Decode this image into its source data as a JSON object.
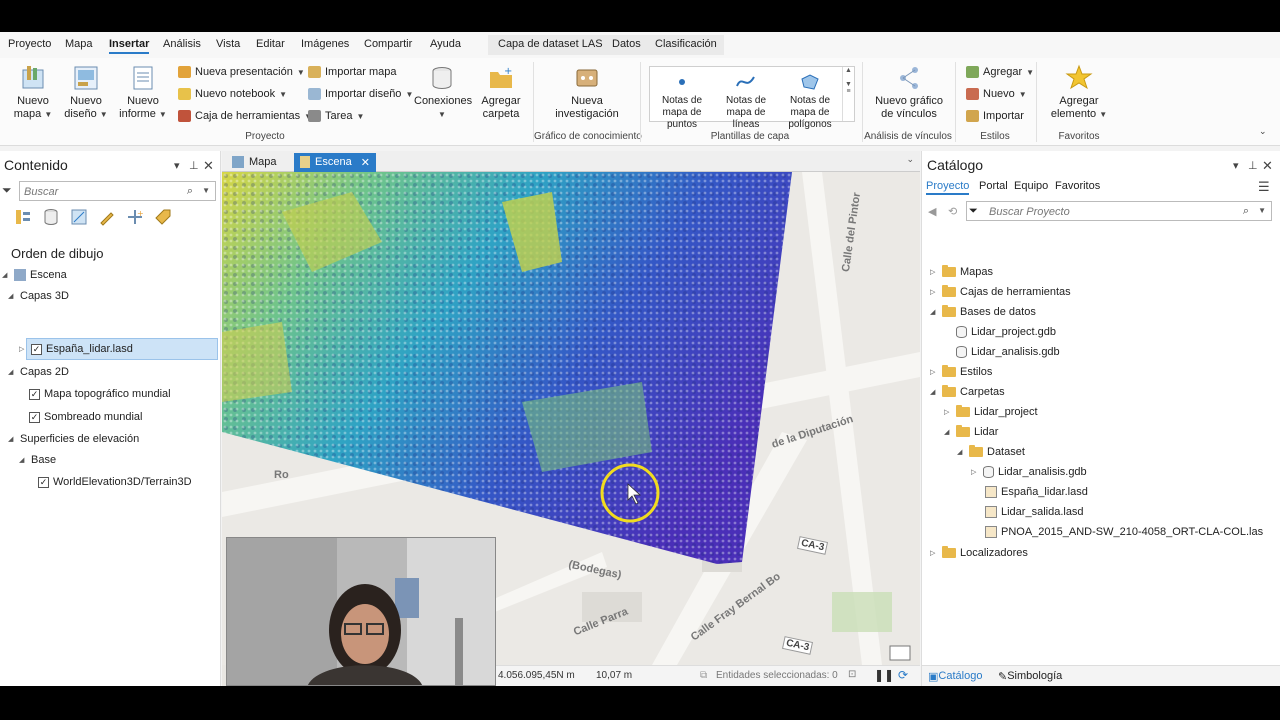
{
  "ribbon_tabs": [
    "Proyecto",
    "Mapa",
    "Insertar",
    "Análisis",
    "Vista",
    "Editar",
    "Imágenes",
    "Compartir",
    "Ayuda"
  ],
  "active_tab": "Insertar",
  "contextual_tabs": [
    "Capa de dataset LAS",
    "Datos",
    "Clasificación"
  ],
  "ribbon": {
    "nuevo_mapa": "Nuevo mapa",
    "nuevo_diseno": "Nuevo diseño",
    "nuevo_informe": "Nuevo informe",
    "nueva_presentacion": "Nueva presentación",
    "nuevo_notebook": "Nuevo notebook",
    "caja_herramientas": "Caja de herramientas",
    "importar_mapa": "Importar mapa",
    "importar_diseno": "Importar diseño",
    "tarea": "Tarea",
    "conexiones": "Conexiones",
    "agregar_carpeta": "Agregar carpeta",
    "group_proyecto": "Proyecto",
    "nueva_investigacion": "Nueva investigación",
    "group_grafico": "Gráfico de conocimiento",
    "notas_puntos": "Notas de mapa de puntos",
    "notas_lineas": "Notas de mapa de líneas",
    "notas_poligonos": "Notas de mapa de polígonos",
    "group_plantillas": "Plantillas de capa",
    "nuevo_grafico_vinculos": "Nuevo gráfico de vínculos",
    "group_analisis_vinculos": "Análisis de vínculos",
    "agregar": "Agregar",
    "nuevo": "Nuevo",
    "importar": "Importar",
    "group_estilos": "Estilos",
    "agregar_elemento": "Agregar elemento",
    "group_favoritos": "Favoritos"
  },
  "contents": {
    "title": "Contenido",
    "search_placeholder": "Buscar",
    "draw_order": "Orden de dibujo",
    "escena": "Escena",
    "capas3d": "Capas 3D",
    "layer_lidar": "España_lidar.lasd",
    "capas2d": "Capas 2D",
    "layer_topo": "Mapa topográfico mundial",
    "layer_sombreado": "Sombreado mundial",
    "superficies": "Superficies de elevación",
    "base": "Base",
    "layer_terrain": "WorldElevation3D/Terrain3D"
  },
  "view": {
    "tab_mapa": "Mapa",
    "tab_escena": "Escena",
    "streets": [
      "Calle del Pintor",
      "Calle Parra",
      "(Bodegas)",
      "Calle Fray Bernal Bo",
      "de la Diputación",
      "CA-3",
      "CA-3",
      "Ro"
    ],
    "coordinate": "4.056.095,45N m",
    "scale": "10,07 m",
    "selected": "Entidades seleccionadas: 0"
  },
  "catalog": {
    "title": "Catálogo",
    "tabs": [
      "Proyecto",
      "Portal",
      "Equipo",
      "Favoritos"
    ],
    "search_placeholder": "Buscar Proyecto",
    "items": {
      "mapas": "Mapas",
      "cajas": "Cajas de herramientas",
      "bases": "Bases de datos",
      "gdb1": "Lidar_project.gdb",
      "gdb2": "Lidar_analisis.gdb",
      "estilos": "Estilos",
      "carpetas": "Carpetas",
      "f_project": "Lidar_project",
      "f_lidar": "Lidar",
      "f_dataset": "Dataset",
      "d_gdb": "Lidar_analisis.gdb",
      "d_lasd1": "España_lidar.lasd",
      "d_lasd2": "Lidar_salida.lasd",
      "d_las": "PNOA_2015_AND-SW_210-4058_ORT-CLA-COL.las",
      "localizadores": "Localizadores"
    },
    "bottom_tab_catalogo": "Catálogo",
    "bottom_tab_simbologia": "Simbología"
  },
  "colors": {
    "accent": "#2a7bc8",
    "selected_row": "#cde3f7"
  }
}
